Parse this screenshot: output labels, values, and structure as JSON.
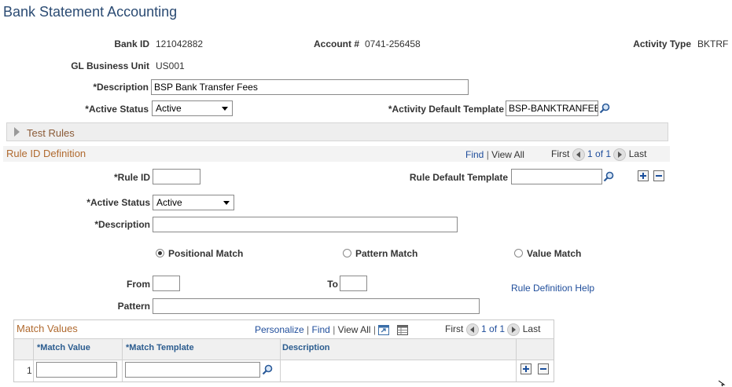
{
  "page": {
    "title": "Bank Statement Accounting"
  },
  "header": {
    "bank_id_label": "Bank ID",
    "bank_id_value": "121042882",
    "account_label": "Account #",
    "account_value": "0741-256458",
    "activity_type_label": "Activity Type",
    "activity_type_value": "BKTRF",
    "gl_bu_label": "GL Business Unit",
    "gl_bu_value": "US001",
    "description_label": "*Description",
    "description_value": "BSP Bank Transfer Fees",
    "active_status_label": "*Active Status",
    "active_status_value": "Active",
    "activity_template_label": "*Activity Default Template",
    "activity_template_value": "BSP-BANKTRANFEE"
  },
  "test_rules": {
    "label": "Test Rules"
  },
  "rule_section": {
    "title": "Rule ID Definition",
    "find": "Find",
    "sep": "|",
    "view_all": "View All",
    "first": "First",
    "range": "1 of 1",
    "last": "Last",
    "rule_id_label": "*Rule ID",
    "rule_id_value": "",
    "rule_template_label": "Rule Default Template",
    "rule_template_value": "",
    "active_status_label": "*Active Status",
    "active_status_value": "Active",
    "description_label": "*Description",
    "description_value": "",
    "radio_positional": "Positional Match",
    "radio_pattern": "Pattern Match",
    "radio_value": "Value Match",
    "selected_match": "positional",
    "from_label": "From",
    "from_value": "",
    "to_label": "To",
    "to_value": "",
    "help_link": "Rule Definition Help",
    "pattern_label": "Pattern",
    "pattern_value": ""
  },
  "match_values": {
    "title": "Match Values",
    "personalize": "Personalize",
    "find": "Find",
    "view_all": "View All",
    "sep": "|",
    "first": "First",
    "range": "1 of 1",
    "last": "Last",
    "columns": [
      "*Match Value",
      "*Match Template",
      "Description"
    ],
    "rows": [
      {
        "num": "1",
        "match_value": "",
        "match_template": "",
        "description": ""
      }
    ]
  },
  "colors": {
    "title": "#2b4b73",
    "section_title": "#b06a2f",
    "link": "#1f4d9b",
    "column_header": "#2b5c8f"
  },
  "icons": [
    "lookup-icon",
    "prev-icon",
    "next-icon",
    "add-row-icon",
    "delete-row-icon",
    "expand-triangle-icon",
    "zoom-grid-icon",
    "download-grid-icon"
  ]
}
